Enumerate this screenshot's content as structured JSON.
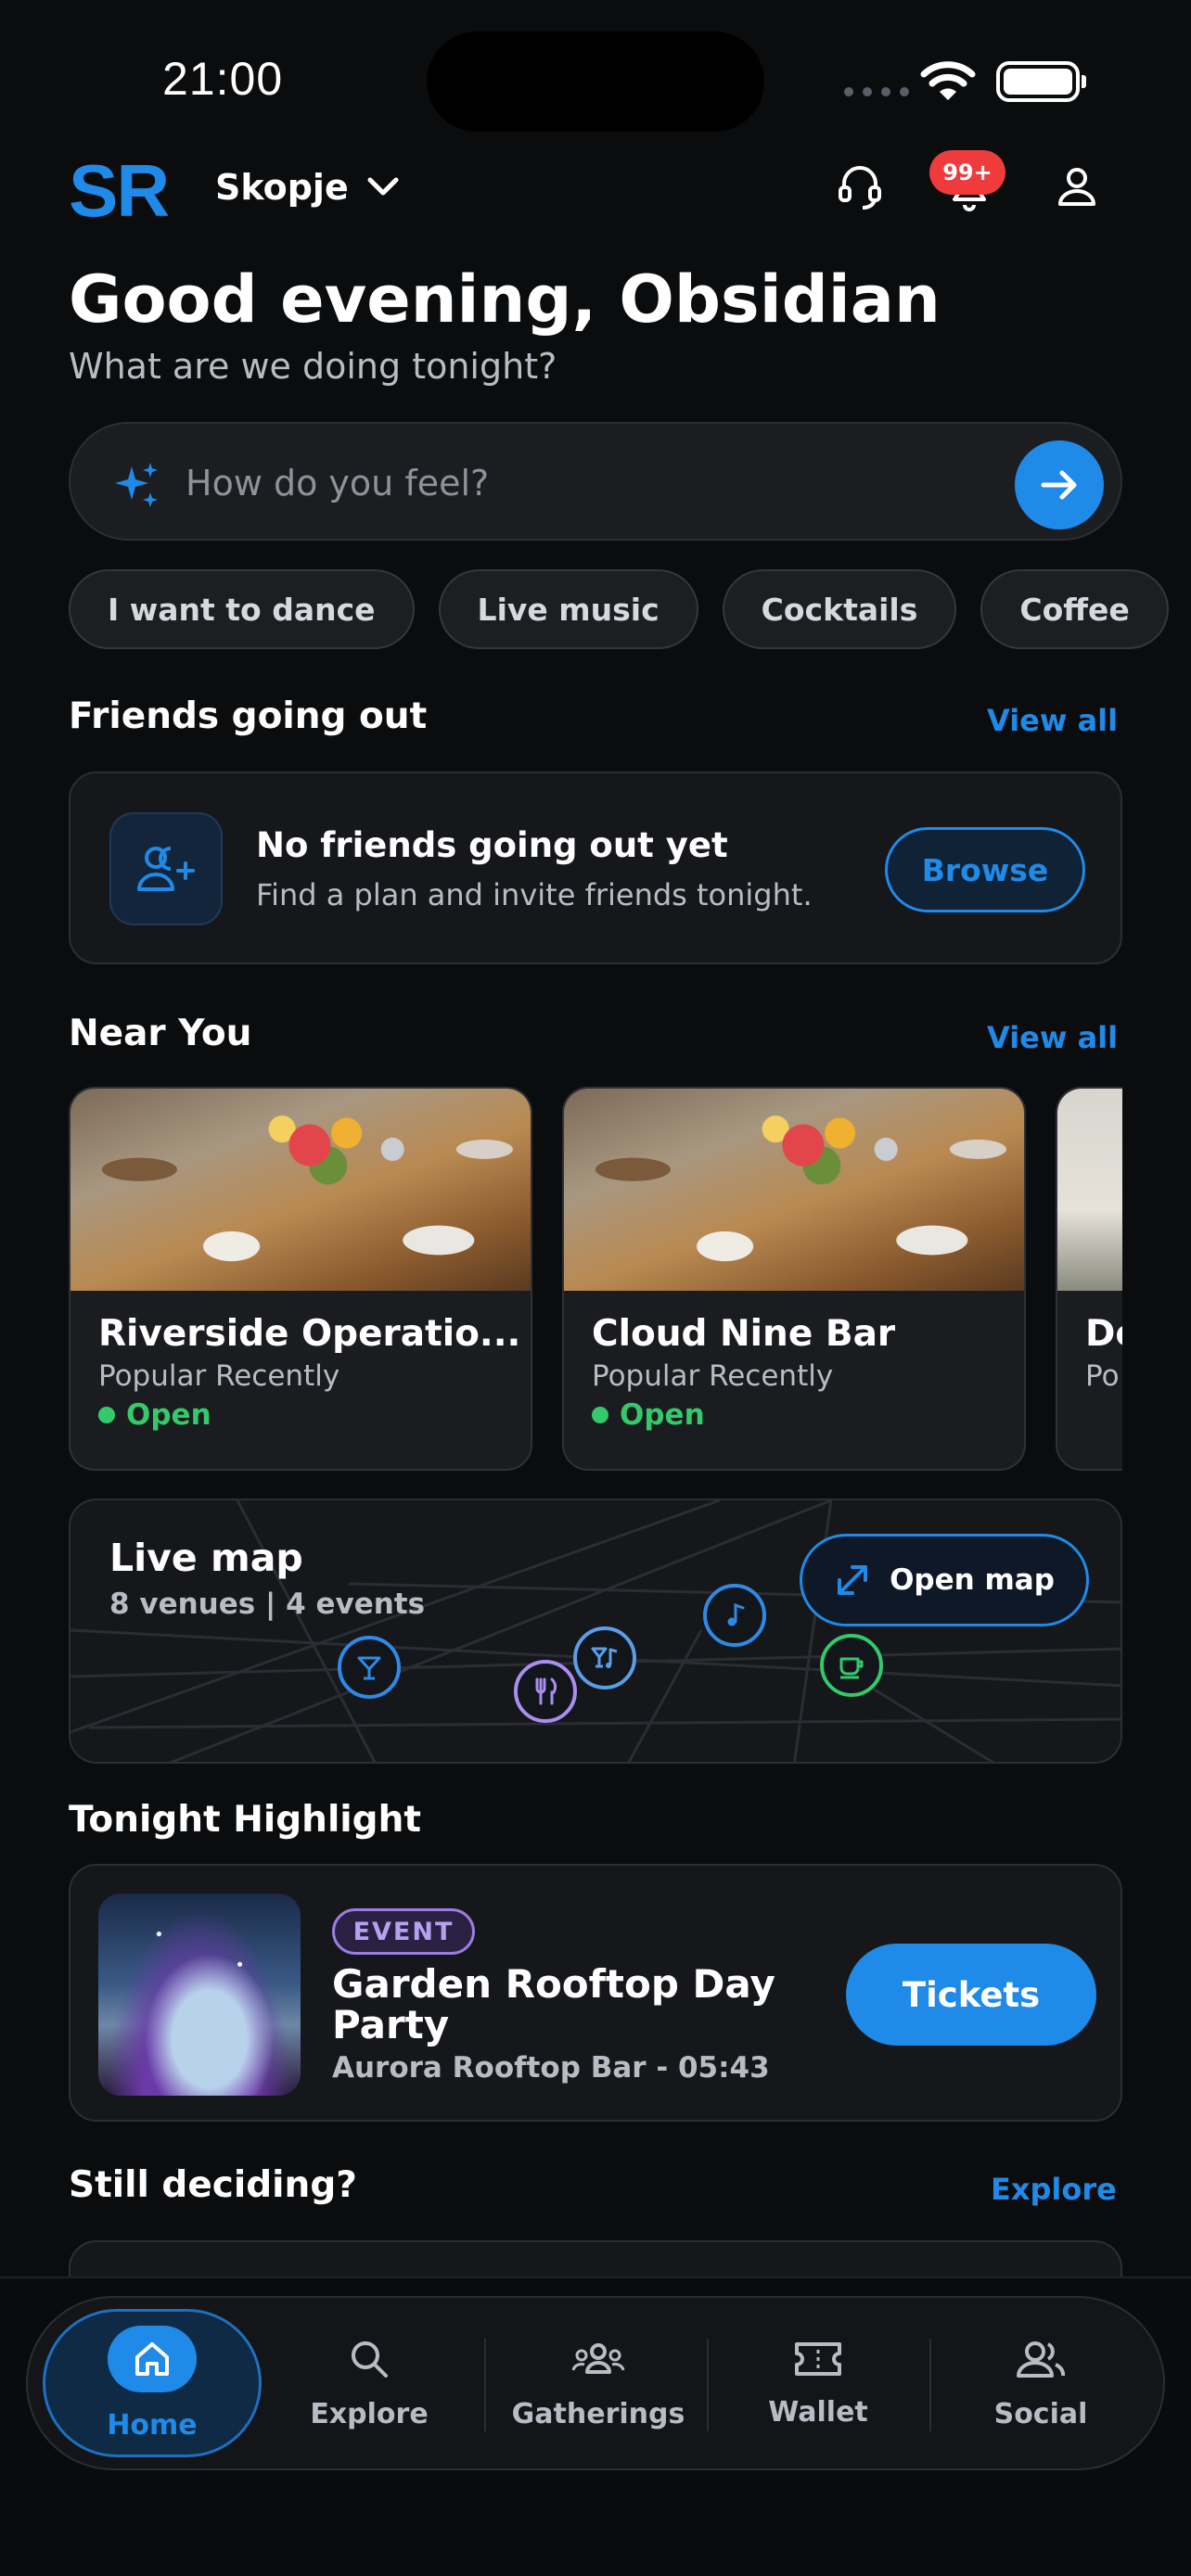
{
  "status_bar": {
    "time": "21:00"
  },
  "header": {
    "logo": "SR",
    "city": "Skopje",
    "notifications_badge": "99+"
  },
  "greeting": {
    "title": "Good evening, Obsidian",
    "subtitle": "What are we doing tonight?"
  },
  "search": {
    "placeholder": "How do you feel?"
  },
  "chips": [
    "I want to dance",
    "Live music",
    "Cocktails",
    "Coffee"
  ],
  "friends": {
    "title": "Friends going out",
    "view_all": "View all",
    "empty_title": "No friends going out yet",
    "empty_subtitle": "Find a plan and invite friends tonight.",
    "browse": "Browse"
  },
  "near_you": {
    "title": "Near You",
    "view_all": "View all",
    "venues": [
      {
        "name": "Riverside Operatio...",
        "subtitle": "Popular Recently",
        "status": "Open"
      },
      {
        "name": "Cloud Nine Bar",
        "subtitle": "Popular Recently",
        "status": "Open"
      },
      {
        "name": "De",
        "subtitle": "Po",
        "status": ""
      }
    ]
  },
  "live_map": {
    "title": "Live map",
    "summary": "8 venues  |  4 events",
    "open_map": "Open map"
  },
  "highlight": {
    "section_title": "Tonight Highlight",
    "tag": "EVENT",
    "title": "Garden Rooftop Day Party",
    "subtitle": "Aurora Rooftop Bar - 05:43",
    "tickets": "Tickets"
  },
  "still_deciding": {
    "title": "Still deciding?",
    "explore": "Explore"
  },
  "nav": [
    "Home",
    "Explore",
    "Gatherings",
    "Wallet",
    "Social"
  ],
  "colors": {
    "accent": "#1f8ae8",
    "open": "#34c96a",
    "badge": "#ef3b3b",
    "event": "#9b7ce0",
    "background": "#0b0c0e"
  }
}
